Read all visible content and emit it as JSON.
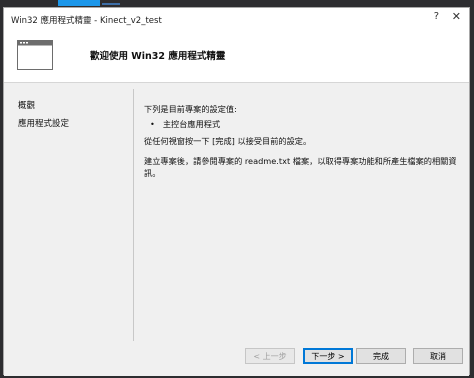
{
  "window": {
    "title": "Win32 應用程式精靈 - Kinect_v2_test",
    "help_glyph": "?",
    "close_glyph": "✕"
  },
  "header": {
    "heading": "歡迎使用 Win32 應用程式精靈",
    "icon": "window-icon"
  },
  "nav": {
    "items": [
      {
        "label": "概觀"
      },
      {
        "label": "應用程式設定"
      }
    ]
  },
  "content": {
    "intro": "下列是目前專案的設定值:",
    "bullet": "主控台應用程式",
    "instruction": "從任何視窗按一下 [完成] 以接受目前的設定。",
    "note": "建立專案後，請參閱專案的 readme.txt 檔案，以取得專案功能和所產生檔案的相關資訊。"
  },
  "buttons": {
    "prev": "< 上一步",
    "next": "下一步 >",
    "finish": "完成",
    "cancel": "取消"
  },
  "colors": {
    "dialog_bg": "#f0f0f0",
    "accent": "#0078d7",
    "ide_tab": "#1c97ea"
  }
}
